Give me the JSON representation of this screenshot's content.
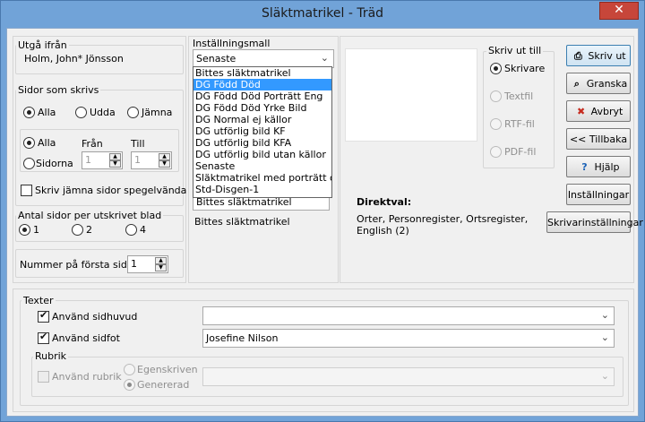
{
  "window": {
    "title": "Släktmatrikel - Träd",
    "close_glyph": "✕"
  },
  "source": {
    "label": "Utgå ifrån",
    "value": "Holm, John* Jönsson"
  },
  "pages": {
    "label": "Sidor som skrivs",
    "options": [
      "Alla",
      "Udda",
      "Jämna"
    ],
    "range_all": "Alla",
    "range_pages": "Sidorna",
    "from_label": "Från",
    "to_label": "Till",
    "from_value": "1",
    "to_value": "1",
    "mirror_label": "Skriv jämna sidor spegelvända"
  },
  "per_sheet": {
    "label": "Antal sidor per utskrivet blad",
    "options": [
      "1",
      "2",
      "4"
    ]
  },
  "first_page": {
    "label": "Nummer på första sidan",
    "value": "1"
  },
  "template": {
    "label": "Inställningsmall",
    "selected": "Senaste",
    "items": [
      "Bittes släktmatrikel",
      "DG Född Död",
      "DG Född Död Porträtt  Eng",
      "DG Född Död Yrke Bild",
      "DG Normal ej källor",
      "DG utförlig bild KF",
      "DG utförlig bild KFA",
      "DG utförlig bild utan källor",
      "Senaste",
      "Släktmatrikel med porträtt och b",
      "Std-Disgen-1"
    ],
    "highlighted_index": 1,
    "behind_value": "Bittes släktmatrikel",
    "behind_label": "Bittes släktmatrikel"
  },
  "output": {
    "label": "Skriv ut till",
    "options": [
      "Skrivare",
      "Textfil",
      "RTF-fil",
      "PDF-fil"
    ]
  },
  "direct": {
    "label": "Direktval:",
    "text_line1": "Orter, Personregister, Ortsregister,",
    "text_line2": "English (2)"
  },
  "buttons": {
    "print": "Skriv ut",
    "preview": "Granska",
    "cancel": "Avbryt",
    "back": "<< Tillbaka",
    "help": "Hjälp",
    "settings": "Inställningar",
    "printer_settings": "Skrivarinställningar"
  },
  "texts": {
    "label": "Texter",
    "header_label": "Använd sidhuvud",
    "header_value": "",
    "footer_label": "Använd sidfot",
    "footer_value": "Josefine Nilson"
  },
  "rubric": {
    "label": "Rubrik",
    "use_label": "Använd rubrik",
    "custom_label": "Egenskriven",
    "generated_label": "Genererad",
    "value": ""
  },
  "colors": {
    "title_bar": "#71a3d8",
    "close": "#c7463a",
    "highlight": "#3399ff"
  }
}
